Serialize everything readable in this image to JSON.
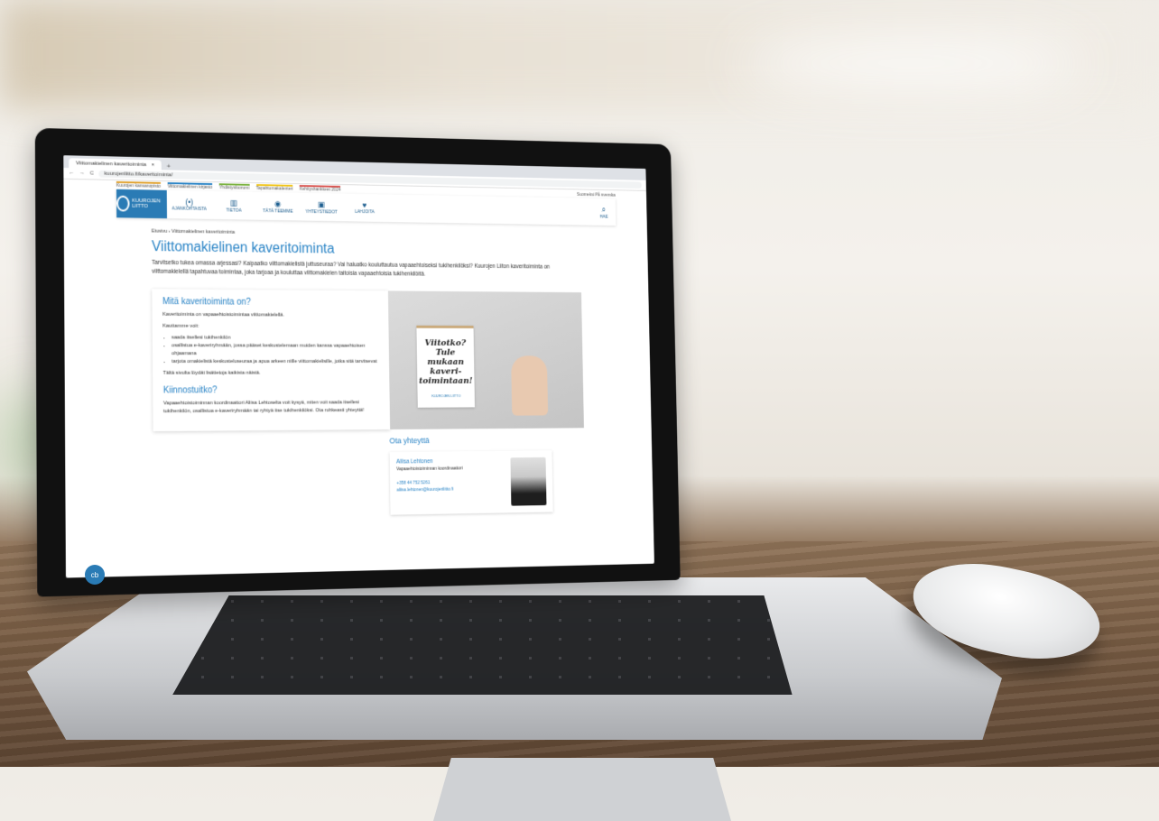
{
  "browser": {
    "tab_title": "Viittomakielinen kaveritoiminta",
    "tab_close": "×",
    "new_tab": "+",
    "url": "kuurojenliitto.fi/kaveritoiminta/",
    "back": "←",
    "forward": "→",
    "reload": "C"
  },
  "toplinks": {
    "items": [
      "Kuurojen kansanopisto",
      "Viittomakielinen kirjasto",
      "Yhdistysfoorumi",
      "Tapahtumakalenteri",
      "Kehityshankkeet 2024"
    ],
    "lang": "Suomeksi   På svenska"
  },
  "nav": {
    "logo_text": "KUUROJEN LIITTO",
    "items": [
      {
        "icon": "(•)",
        "label": "AJANKOHTAISTA"
      },
      {
        "icon": "▥",
        "label": "TIETOA"
      },
      {
        "icon": "◉",
        "label": "TÄTÄ TEEMME"
      },
      {
        "icon": "▣",
        "label": "YHTEYSTIEDOT"
      },
      {
        "icon": "♥",
        "label": "LAHJOITA"
      }
    ],
    "search_icon": "⌕",
    "search_label": "HAE"
  },
  "page": {
    "breadcrumb": "Etusivu › Viittomakielinen kaveritoiminta",
    "title": "Viittomakielinen kaveritoiminta",
    "intro": "Tarvitsetko tukea omassa arjessasi? Kaipaatko viittomakielistä juttuseuraa? Vai haluatko kouluttautua vapaaehtoiseksi tukihenkilöksi? Kuurojen Liiton kaveritoiminta on viittomakielellä tapahtuvaa toimintaa, joka tarjoaa ja kouluttaa viittomakielen taitoisia vapaaehtoisia tukihenkilöitä."
  },
  "card": {
    "heading": "Mitä kaveritoiminta on?",
    "p1": "Kaveritoiminta on vapaaehtoistoimintaa viittomakielellä.",
    "p2": "Kauttamme voit:",
    "list": [
      "saada itsellesi tukihenkilön",
      "osallistua e-kaveriryhmään, jossa pääset keskustelemaan muiden kanssa vapaaehtoisen ohjaamana",
      "tarjota omakielistä keskusteluseuraa ja apua arkeen niille viittomakielisille, jotka sitä tarvitsevat"
    ],
    "p3": "Tältä sivulta löydät lisätietoja kaikista näistä.",
    "heading2": "Kiinnostuitko?",
    "p4": "Vapaaehtoistoiminnan koordinaattori Aliisa Lehtoselta voit kysyä, miten voit saada itsellesi tukihenkilön, osallistua e-kaveriryhmään tai ryhtyä itse tukihenkilöksi. Ota rohkeasti yhteyttä!"
  },
  "poster": {
    "line1": "Viitotko?",
    "line2": "Tule mukaan",
    "line3": "kaveri-",
    "line4": "toimintaan!",
    "logo": "KUUROJEN LIITTO"
  },
  "contact": {
    "heading": "Ota yhteyttä",
    "name": "Aliisa Lehtonen",
    "role": "Vapaaehtoistoiminnan koordinaattori",
    "phone": "+358 44 752 5261",
    "email": "aliisa.lehtonen@kuurojenliitto.fi"
  },
  "chat": {
    "label": "cb"
  }
}
